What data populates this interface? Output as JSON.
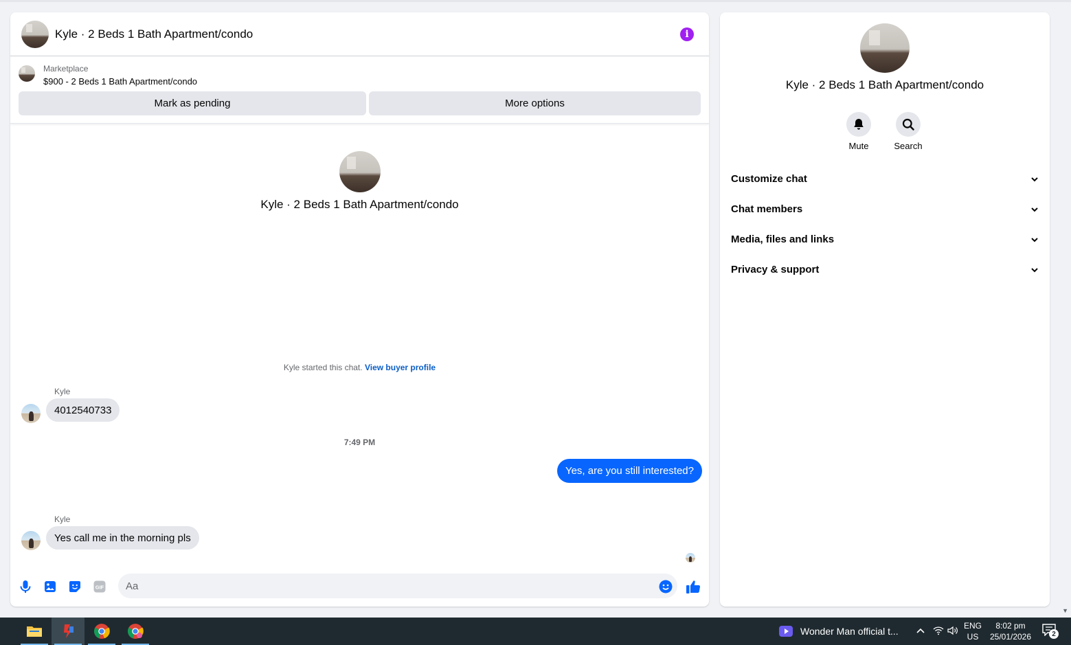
{
  "chat": {
    "header_title": "Kyle · 2 Beds 1 Bath Apartment/condo",
    "info_glyph": "i",
    "listing": {
      "source": "Marketplace",
      "description": "$900 - 2 Beds 1 Bath Apartment/condo"
    },
    "actions": {
      "pending_label": "Mark as pending",
      "more_label": "More options"
    },
    "intro_name": "Kyle · 2 Beds 1 Bath Apartment/condo",
    "started_text": "Kyle started this chat.",
    "view_profile_link": "View buyer profile",
    "messages": [
      {
        "sender": "Kyle",
        "text": "4012540733"
      },
      {
        "text": "Yes, are you still interested?"
      },
      {
        "sender": "Kyle",
        "text": "Yes call me in the morning pls"
      }
    ],
    "timestamp": "7:49 PM",
    "composer": {
      "placeholder": "Aa",
      "gif_label": "GIF"
    }
  },
  "side": {
    "name": "Kyle · 2 Beds 1 Bath Apartment/condo",
    "actions": [
      {
        "label": "Mute",
        "icon": "bell-icon"
      },
      {
        "label": "Search",
        "icon": "search-icon"
      }
    ],
    "sections": [
      "Customize chat",
      "Chat members",
      "Media, files and links",
      "Privacy & support"
    ]
  },
  "taskbar": {
    "media_title": "Wonder Man official t...",
    "lang": "ENG",
    "region": "US",
    "time": "8:02 pm",
    "date": "25/01/2026",
    "notification_count": "2"
  },
  "colors": {
    "accent_blue": "#0866ff",
    "info_purple": "#a020f0",
    "link_blue": "#0a5ec6"
  }
}
